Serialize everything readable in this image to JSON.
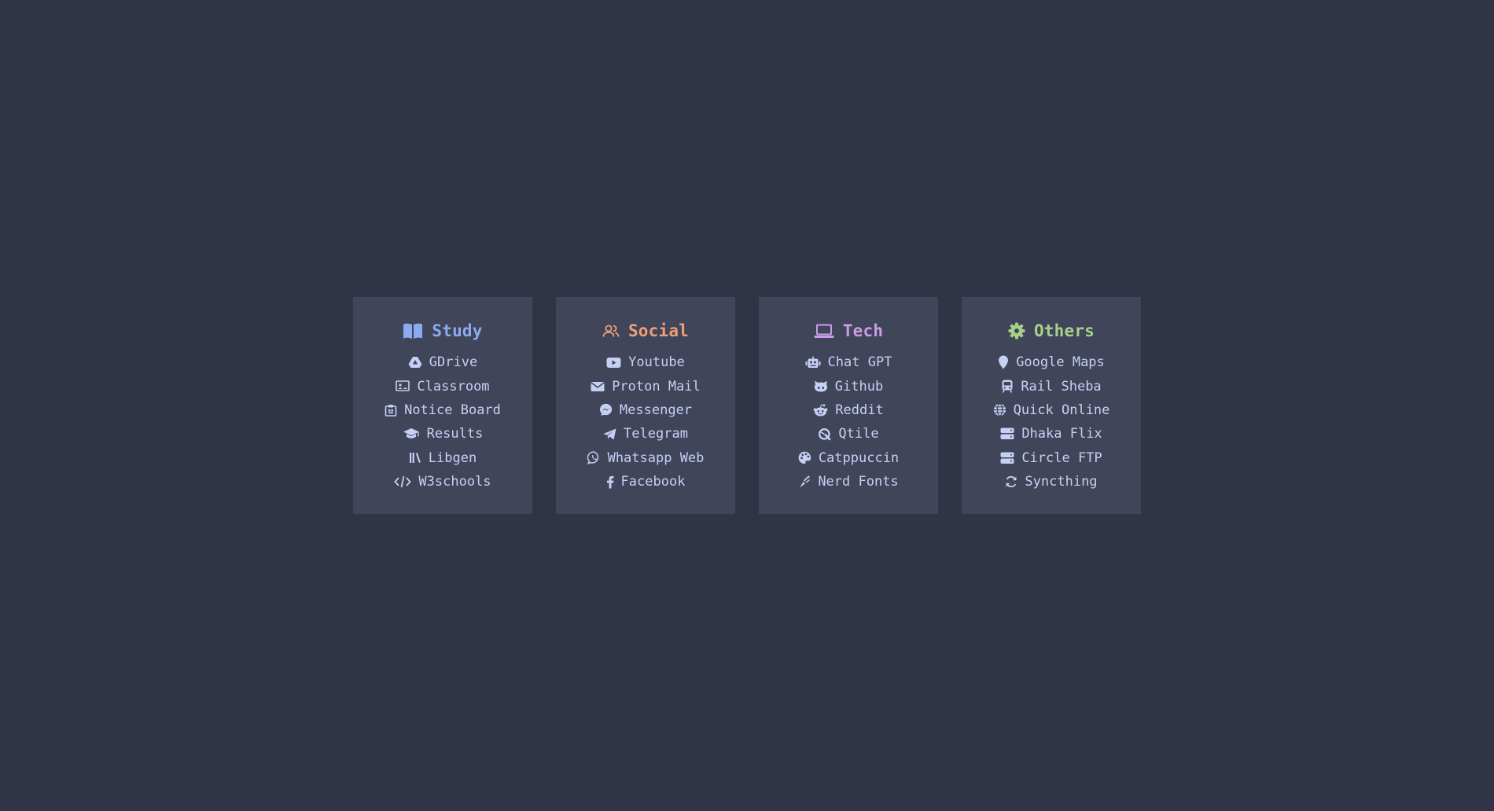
{
  "colors": {
    "background": "#303446",
    "card": "#414559",
    "text": "#c6d0f5",
    "study": "#8caaee",
    "social": "#ef9f76",
    "tech": "#ca9ee6",
    "others": "#a6d189"
  },
  "cards": [
    {
      "title": "Study",
      "icon": "book-open-icon",
      "links": [
        {
          "label": "GDrive",
          "icon": "google-drive-icon"
        },
        {
          "label": "Classroom",
          "icon": "chalkboard-icon"
        },
        {
          "label": "Notice Board",
          "icon": "clipboard-icon"
        },
        {
          "label": "Results",
          "icon": "graduation-cap-icon"
        },
        {
          "label": "Libgen",
          "icon": "books-icon"
        },
        {
          "label": "W3schools",
          "icon": "code-icon"
        }
      ]
    },
    {
      "title": "Social",
      "icon": "users-icon",
      "links": [
        {
          "label": "Youtube",
          "icon": "youtube-icon"
        },
        {
          "label": "Proton Mail",
          "icon": "envelope-icon"
        },
        {
          "label": "Messenger",
          "icon": "messenger-icon"
        },
        {
          "label": "Telegram",
          "icon": "telegram-icon"
        },
        {
          "label": "Whatsapp Web",
          "icon": "whatsapp-icon"
        },
        {
          "label": "Facebook",
          "icon": "facebook-icon"
        }
      ]
    },
    {
      "title": "Tech",
      "icon": "laptop-icon",
      "links": [
        {
          "label": "Chat GPT",
          "icon": "robot-icon"
        },
        {
          "label": "Github",
          "icon": "github-icon"
        },
        {
          "label": "Reddit",
          "icon": "reddit-icon"
        },
        {
          "label": "Qtile",
          "icon": "qtile-icon"
        },
        {
          "label": "Catppuccin",
          "icon": "palette-icon"
        },
        {
          "label": "Nerd Fonts",
          "icon": "nerd-fonts-icon"
        }
      ]
    },
    {
      "title": "Others",
      "icon": "gear-icon",
      "links": [
        {
          "label": "Google Maps",
          "icon": "map-pin-icon"
        },
        {
          "label": "Rail Sheba",
          "icon": "train-icon"
        },
        {
          "label": "Quick Online",
          "icon": "globe-icon"
        },
        {
          "label": "Dhaka Flix",
          "icon": "server-icon"
        },
        {
          "label": "Circle FTP",
          "icon": "server-icon"
        },
        {
          "label": "Syncthing",
          "icon": "sync-icon"
        }
      ]
    }
  ]
}
